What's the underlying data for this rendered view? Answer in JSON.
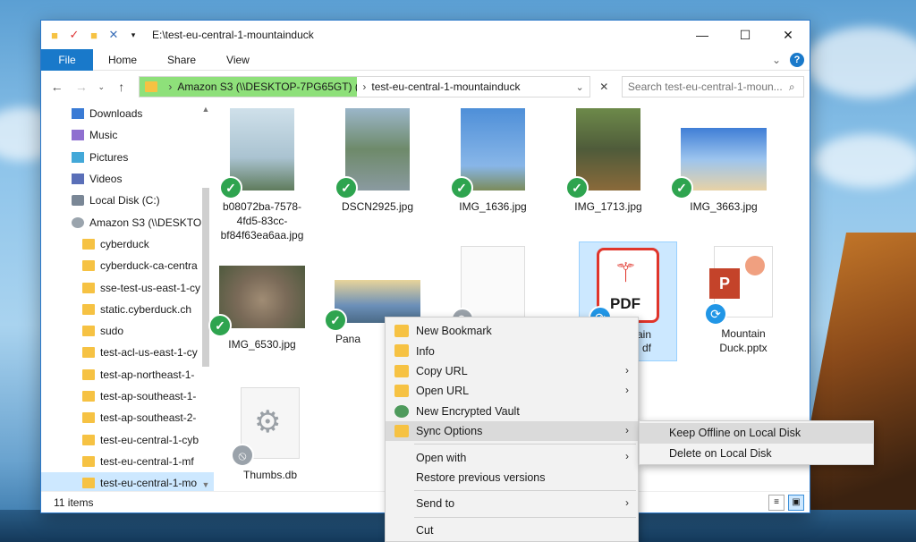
{
  "window": {
    "title": "E:\\test-eu-central-1-mountainduck"
  },
  "ribbon": {
    "tabs": [
      "File",
      "Home",
      "Share",
      "View"
    ]
  },
  "address": {
    "crumb_root": "Amazon S3 (\\\\DESKTOP-7PG65GT) (...",
    "crumb_current": "test-eu-central-1-mountainduck",
    "search_placeholder": "Search test-eu-central-1-moun..."
  },
  "nav": {
    "items": [
      {
        "label": "Downloads",
        "icon": "downloads-icon",
        "level": 0
      },
      {
        "label": "Music",
        "icon": "music-icon",
        "level": 0
      },
      {
        "label": "Pictures",
        "icon": "pictures-icon",
        "level": 0
      },
      {
        "label": "Videos",
        "icon": "videos-icon",
        "level": 0
      },
      {
        "label": "Local Disk (C:)",
        "icon": "disk-icon",
        "level": 0
      },
      {
        "label": "Amazon S3 (\\\\DESKTOP",
        "icon": "network-drive-icon",
        "level": 0
      },
      {
        "label": "cyberduck",
        "icon": "folder-icon",
        "level": 1
      },
      {
        "label": "cyberduck-ca-centra",
        "icon": "folder-icon",
        "level": 1
      },
      {
        "label": "sse-test-us-east-1-cy",
        "icon": "folder-icon",
        "level": 1
      },
      {
        "label": "static.cyberduck.ch",
        "icon": "folder-icon",
        "level": 1
      },
      {
        "label": "sudo",
        "icon": "folder-icon",
        "level": 1
      },
      {
        "label": "test-acl-us-east-1-cy",
        "icon": "folder-icon",
        "level": 1
      },
      {
        "label": "test-ap-northeast-1-",
        "icon": "folder-icon",
        "level": 1
      },
      {
        "label": "test-ap-southeast-1-",
        "icon": "folder-icon",
        "level": 1
      },
      {
        "label": "test-ap-southeast-2-",
        "icon": "folder-icon",
        "level": 1
      },
      {
        "label": "test-eu-central-1-cyb",
        "icon": "folder-icon",
        "level": 1
      },
      {
        "label": "test-eu-central-1-mf",
        "icon": "folder-icon",
        "level": 1
      },
      {
        "label": "test-eu-central-1-mo",
        "icon": "folder-icon",
        "level": 1
      }
    ]
  },
  "files": [
    {
      "name": "b08072ba-7578-4fd5-83cc-bf84f63ea6aa.jpg",
      "status": "synced"
    },
    {
      "name": "DSCN2925.jpg",
      "status": "synced"
    },
    {
      "name": "IMG_1636.jpg",
      "status": "synced"
    },
    {
      "name": "IMG_1713.jpg",
      "status": "synced"
    },
    {
      "name": "IMG_3663.jpg",
      "status": "synced"
    },
    {
      "name": "IMG_6530.jpg",
      "status": "synced"
    },
    {
      "name": "Pana",
      "status": "synced"
    },
    {
      "name": "",
      "status": "syncing"
    },
    {
      "name": "PDF",
      "status": "syncing",
      "label_partial_1": "ain",
      "label_partial_2": "df"
    },
    {
      "name": "Mountain Duck.pptx",
      "status": "syncing"
    },
    {
      "name": "Thumbs.db",
      "status": "excluded"
    }
  ],
  "statusbar": {
    "count": "11 items"
  },
  "context_menu": {
    "items": [
      {
        "label": "New Bookmark",
        "has_submenu": false
      },
      {
        "label": "Info",
        "has_submenu": false
      },
      {
        "label": "Copy URL",
        "has_submenu": true
      },
      {
        "label": "Open URL",
        "has_submenu": true
      },
      {
        "label": "New Encrypted Vault",
        "has_submenu": false
      },
      {
        "label": "Sync Options",
        "has_submenu": true
      },
      {
        "label": "Open with",
        "has_submenu": true
      },
      {
        "label": "Restore previous versions",
        "has_submenu": false
      },
      {
        "label": "Send to",
        "has_submenu": true
      },
      {
        "label": "Cut",
        "has_submenu": false
      }
    ],
    "submenu": [
      "Keep Offline on Local Disk",
      "Delete on Local Disk"
    ]
  },
  "colors": {
    "accent": "#1979ca",
    "crumb_highlight": "#8ee07a",
    "synced_badge": "#2ea44f",
    "syncing_badge": "#2196e6",
    "selection": "#cce8ff"
  }
}
